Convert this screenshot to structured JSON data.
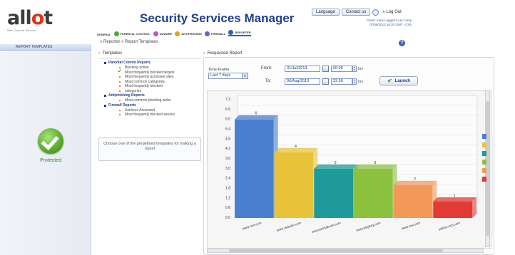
{
  "header": {
    "logo": "allot",
    "logo_sub": "See Control Secure",
    "title": "Security Services Manager",
    "language": "Language",
    "contact": "Contact us",
    "logout": "Log Out",
    "user_line1": "Client: tomy    Logged in as: tomy",
    "user_line2": "07/08/2013 16:20 GMT +2:00"
  },
  "services": [
    {
      "label": "GENERAL",
      "color": ""
    },
    {
      "label": "PARENTAL CONTROL",
      "color": "#4ea73a"
    },
    {
      "label": "ADWARE",
      "color": "#c84ec8"
    },
    {
      "label": "ANTIPHISHING",
      "color": "#e2a21a"
    },
    {
      "label": "FIREWALL",
      "color": "#7a5ac8"
    },
    {
      "label": "REPORTER",
      "color": "#2f5fb5"
    }
  ],
  "sidebar": {
    "tab": "REPORT TEMPLATES",
    "status": "Protected"
  },
  "breadcrumb": "» Reporter » Report Templates",
  "templates": {
    "header": "Templates",
    "groups": [
      {
        "name": "Parental Control Reports",
        "items": [
          "Blocking action",
          "Most frequently blocked targets",
          "Most frequently accessed sites",
          "Most common categories",
          "Most frequently blocked",
          "categories"
        ]
      },
      {
        "name": "Antiphishing Reports",
        "items": [
          "Most common phishing webs"
        ]
      },
      {
        "name": "Firewall Reports",
        "items": [
          "Services Accessed",
          "Most frequently blocked service"
        ]
      }
    ],
    "hint": "Choose one of the predefined templates for making a report"
  },
  "request": {
    "header": "Requested Report",
    "time_frame_label": "Time Frame",
    "time_frame_value": "Last 7 days",
    "from_label": "From:",
    "to_label": "To:",
    "from_date": "31/Jul/2013",
    "to_date": "06/Aug/2013",
    "from_time": "00:00",
    "to_time": "23:59",
    "hrs": "hrs",
    "launch": "Launch"
  },
  "chart_data": {
    "type": "bar",
    "categories": [
      "www.cnn.com",
      "www.redtube.com",
      "www.beintabuse.com",
      "www.playboy.com",
      "www.sex.com",
      "edition.cnn.com"
    ],
    "values": [
      6,
      4,
      3,
      3,
      2,
      1
    ],
    "colors": [
      "#4a7fd0",
      "#e8c33a",
      "#1f9a9a",
      "#8cc13f",
      "#f2995a",
      "#e23b35"
    ],
    "yticks": [
      "0.0",
      "0.6",
      "1.2",
      "1.8",
      "2.4",
      "3.0",
      "3.6",
      "4.2",
      "4.8",
      "5.4",
      "6.0",
      "6.6",
      "7.2"
    ],
    "ylim": [
      0,
      7.2
    ]
  }
}
